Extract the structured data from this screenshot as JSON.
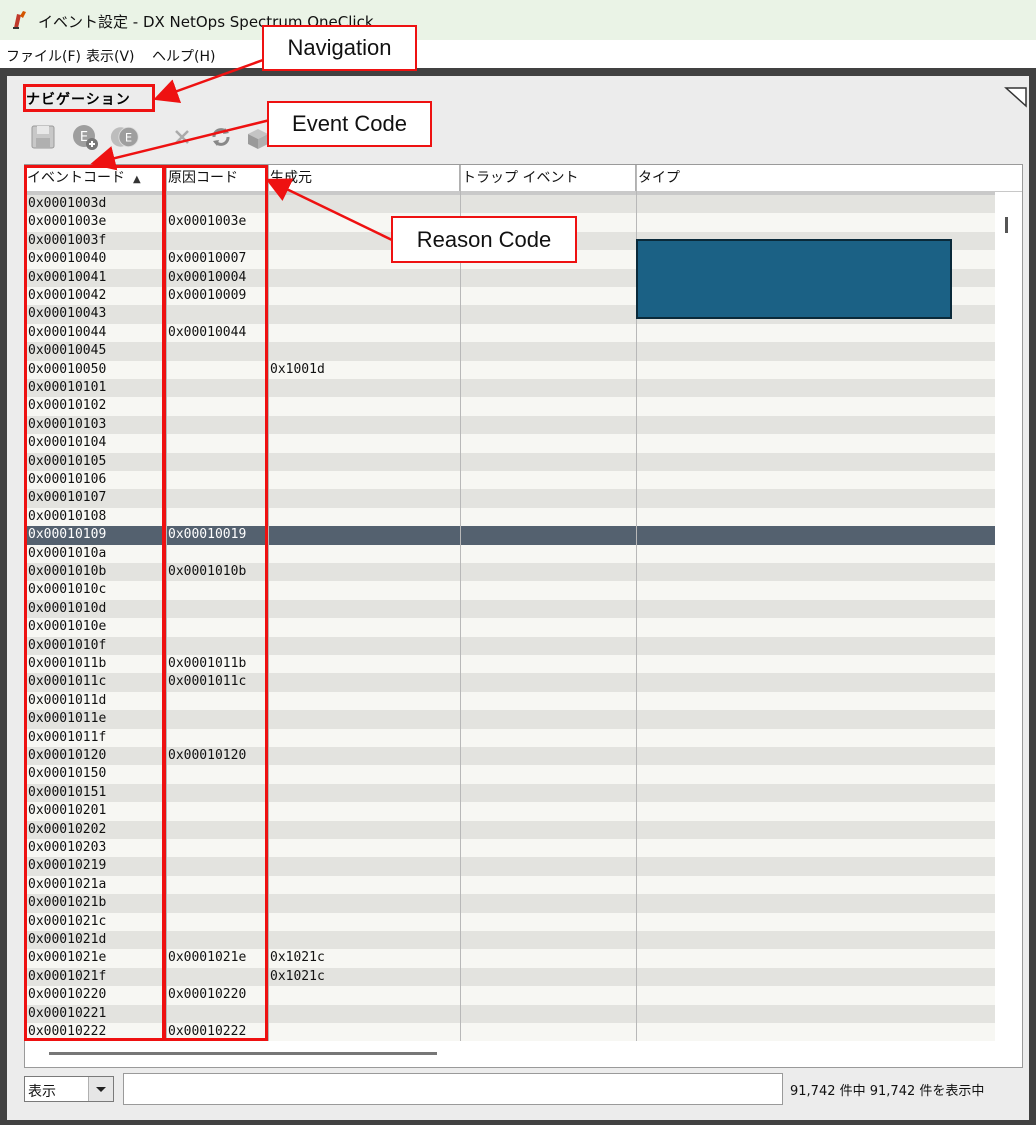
{
  "window": {
    "title": "イベント設定 - DX NetOps Spectrum OneClick",
    "app_icon": "pencil-icon"
  },
  "menu": [
    "ファイル(F)",
    "表示(V)",
    "ヘルプ(H)"
  ],
  "navigation": {
    "title": "ナビゲーション"
  },
  "toolbar": {
    "icons": [
      "save-icon",
      "add-event-icon",
      "copy-event-icon",
      "delete-icon",
      "refresh-icon",
      "export-icon"
    ]
  },
  "table": {
    "columns": [
      {
        "label": "イベントコード",
        "sorted": "ascending"
      },
      {
        "label": "原因コード"
      },
      {
        "label": "生成元"
      },
      {
        "label": "トラップ イベント"
      },
      {
        "label": "タイプ"
      }
    ],
    "selected_row": 18,
    "rows": [
      [
        "0x0001003d",
        "",
        ""
      ],
      [
        "0x0001003e",
        "0x0001003e",
        ""
      ],
      [
        "0x0001003f",
        "",
        ""
      ],
      [
        "0x00010040",
        "0x00010007",
        ""
      ],
      [
        "0x00010041",
        "0x00010004",
        ""
      ],
      [
        "0x00010042",
        "0x00010009",
        ""
      ],
      [
        "0x00010043",
        "",
        ""
      ],
      [
        "0x00010044",
        "0x00010044",
        ""
      ],
      [
        "0x00010045",
        "",
        ""
      ],
      [
        "0x00010050",
        "",
        "0x1001d"
      ],
      [
        "0x00010101",
        "",
        ""
      ],
      [
        "0x00010102",
        "",
        ""
      ],
      [
        "0x00010103",
        "",
        ""
      ],
      [
        "0x00010104",
        "",
        ""
      ],
      [
        "0x00010105",
        "",
        ""
      ],
      [
        "0x00010106",
        "",
        ""
      ],
      [
        "0x00010107",
        "",
        ""
      ],
      [
        "0x00010108",
        "",
        ""
      ],
      [
        "0x00010109",
        "0x00010019",
        ""
      ],
      [
        "0x0001010a",
        "",
        ""
      ],
      [
        "0x0001010b",
        "0x0001010b",
        ""
      ],
      [
        "0x0001010c",
        "",
        ""
      ],
      [
        "0x0001010d",
        "",
        ""
      ],
      [
        "0x0001010e",
        "",
        ""
      ],
      [
        "0x0001010f",
        "",
        ""
      ],
      [
        "0x0001011b",
        "0x0001011b",
        ""
      ],
      [
        "0x0001011c",
        "0x0001011c",
        ""
      ],
      [
        "0x0001011d",
        "",
        ""
      ],
      [
        "0x0001011e",
        "",
        ""
      ],
      [
        "0x0001011f",
        "",
        ""
      ],
      [
        "0x00010120",
        "0x00010120",
        ""
      ],
      [
        "0x00010150",
        "",
        ""
      ],
      [
        "0x00010151",
        "",
        ""
      ],
      [
        "0x00010201",
        "",
        ""
      ],
      [
        "0x00010202",
        "",
        ""
      ],
      [
        "0x00010203",
        "",
        ""
      ],
      [
        "0x00010219",
        "",
        ""
      ],
      [
        "0x0001021a",
        "",
        ""
      ],
      [
        "0x0001021b",
        "",
        ""
      ],
      [
        "0x0001021c",
        "",
        ""
      ],
      [
        "0x0001021d",
        "",
        ""
      ],
      [
        "0x0001021e",
        "0x0001021e",
        "0x1021c"
      ],
      [
        "0x0001021f",
        "",
        "0x1021c"
      ],
      [
        "0x00010220",
        "0x00010220",
        ""
      ],
      [
        "0x00010221",
        "",
        ""
      ],
      [
        "0x00010222",
        "0x00010222",
        ""
      ]
    ]
  },
  "footer": {
    "select_value": "表示",
    "filter_value": "",
    "status": "91,742 件中 91,742 件を表示中"
  },
  "annotations": {
    "navigation": "Navigation",
    "event_code": "Event Code",
    "reason_code": "Reason Code"
  },
  "colors": {
    "annotation_red": "#e11111",
    "selection": "#54616f",
    "redaction_box": "#1b6185"
  }
}
